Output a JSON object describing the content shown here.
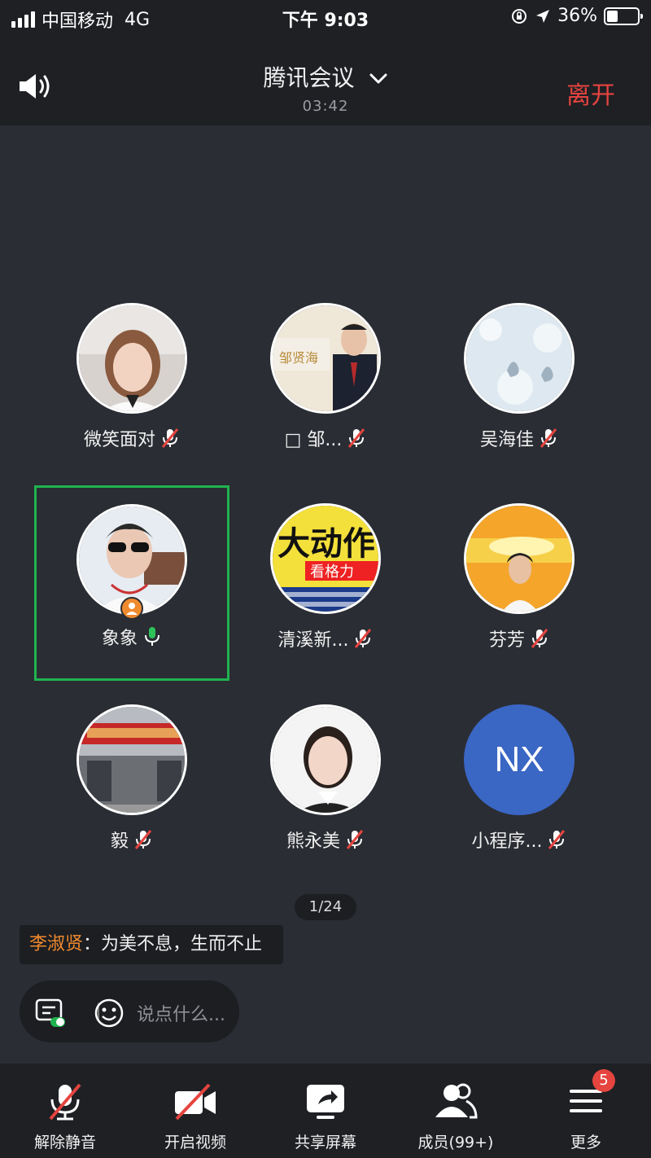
{
  "status_bar": {
    "carrier": "中国移动",
    "network": "4G",
    "time": "下午 9:03",
    "battery": "36%",
    "battery_level": 0.36
  },
  "header": {
    "title": "腾讯会议",
    "timer": "03:42",
    "leave_label": "离开"
  },
  "participants": [
    {
      "name": "微笑面对",
      "mic": "muted",
      "avatar": "photo-woman-short-hair"
    },
    {
      "name": "□ 邹...",
      "mic": "muted",
      "avatar": "photo-man-suit-banner"
    },
    {
      "name": "吴海佳",
      "mic": "muted",
      "avatar": "photo-swans-lake"
    },
    {
      "name": "象象",
      "mic": "active",
      "avatar": "photo-woman-sunglasses",
      "host": true,
      "speaking": true
    },
    {
      "name": "清溪新...",
      "mic": "muted",
      "avatar": "poster-yellow-ad"
    },
    {
      "name": "芬芳",
      "mic": "muted",
      "avatar": "photo-woman-sunset"
    },
    {
      "name": "毅",
      "mic": "muted",
      "avatar": "photo-storefront"
    },
    {
      "name": "熊永美",
      "mic": "muted",
      "avatar": "photo-woman-portrait"
    },
    {
      "name": "小程序...",
      "mic": "muted",
      "avatar_initials": "NX"
    }
  ],
  "pager": "1/24",
  "chat": {
    "sender": "李淑贤",
    "separator": "：",
    "message": "为美不息，生而不止",
    "placeholder": "说点什么..."
  },
  "toolbar": [
    {
      "label": "解除静音",
      "icon": "mic-muted-icon"
    },
    {
      "label": "开启视频",
      "icon": "video-off-icon"
    },
    {
      "label": "共享屏幕",
      "icon": "share-screen-icon"
    },
    {
      "label": "成员(99+)",
      "icon": "members-icon"
    },
    {
      "label": "更多",
      "icon": "more-menu-icon",
      "badge": "5"
    }
  ],
  "colors": {
    "accent_green": "#1fb34f",
    "leave_red": "#e5443f",
    "host_orange": "#f08a2e",
    "nx_blue": "#3a66c4"
  }
}
